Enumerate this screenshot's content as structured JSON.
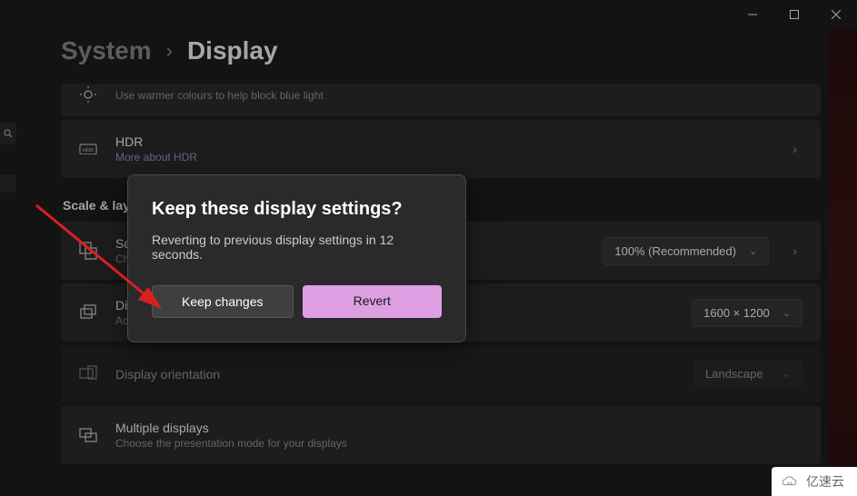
{
  "window": {
    "min": "—",
    "max": "▢",
    "close": "✕"
  },
  "breadcrumb": {
    "sys": "System",
    "sep": "›",
    "cur": "Display"
  },
  "nightlight": {
    "sub": "Use warmer colours to help block blue light"
  },
  "hdr": {
    "title": "HDR",
    "sub": "More about HDR"
  },
  "section_scale_layout": "Scale & layout",
  "scale": {
    "title": "Scale",
    "sub": "Change the size of text, apps, and other items",
    "value": "100% (Recommended)"
  },
  "resolution": {
    "title": "Display resolution",
    "sub": "Adjust the resolution to fit your connected display",
    "value": "1600 × 1200"
  },
  "orientation": {
    "title": "Display orientation",
    "value": "Landscape"
  },
  "multiple": {
    "title": "Multiple displays",
    "sub": "Choose the presentation mode for your displays"
  },
  "modal": {
    "title": "Keep these display settings?",
    "text": "Reverting to previous display settings in 12 seconds.",
    "keep": "Keep changes",
    "revert": "Revert"
  },
  "watermark": "亿速云"
}
